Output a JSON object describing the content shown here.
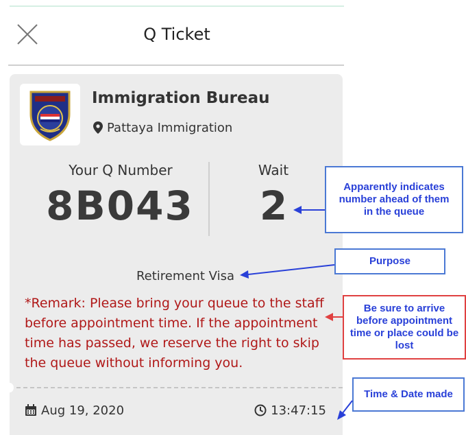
{
  "header": {
    "title": "Q Ticket"
  },
  "ticket": {
    "organization": "Immigration Bureau",
    "location": "Pattaya Immigration",
    "queue_label": "Your Q Number",
    "queue_number": "8B043",
    "wait_label": "Wait",
    "wait_count": "2",
    "purpose": "Retirement Visa",
    "remark": "*Remark: Please bring your queue to the staff before appointment time.  If the appointment time has passed, we reserve the right to skip the queue without informing you.",
    "date": "Aug 19, 2020",
    "time": "13:47:15"
  },
  "annotations": {
    "wait_note": "Apparently indicates number ahead of them in the queue",
    "purpose_note": "Purpose",
    "remark_note": "Be sure to arrive before appointment time or place could be lost",
    "time_note": "Time & Date made"
  },
  "icons": {
    "close": "close-icon",
    "location": "map-pin-icon",
    "date": "calendar-icon",
    "time": "clock-icon",
    "logo": "police-badge-logo"
  },
  "colors": {
    "remark_text": "#b01818",
    "annotation_border_blue": "#4a78d4",
    "annotation_border_red": "#e04040",
    "annotation_text": "#2940d8",
    "card_background": "#ececec"
  }
}
